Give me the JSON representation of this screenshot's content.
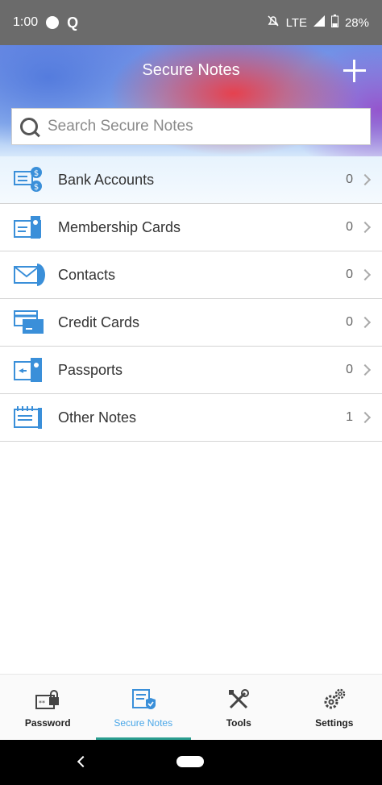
{
  "status_bar": {
    "time": "1:00",
    "network": "LTE",
    "battery": "28%"
  },
  "header": {
    "title": "Secure Notes",
    "add_icon": "plus-icon"
  },
  "search": {
    "placeholder": "Search Secure Notes"
  },
  "categories": [
    {
      "label": "Bank Accounts",
      "count": "0",
      "icon": "bank-accounts-icon"
    },
    {
      "label": "Membership Cards",
      "count": "0",
      "icon": "membership-card-icon"
    },
    {
      "label": "Contacts",
      "count": "0",
      "icon": "contact-envelope-icon"
    },
    {
      "label": "Credit Cards",
      "count": "0",
      "icon": "credit-card-icon"
    },
    {
      "label": "Passports",
      "count": "0",
      "icon": "passport-icon"
    },
    {
      "label": "Other Notes",
      "count": "1",
      "icon": "notepad-icon"
    }
  ],
  "bottom_nav": [
    {
      "label": "Password",
      "icon": "password-lock-icon"
    },
    {
      "label": "Secure Notes",
      "icon": "secure-notes-icon",
      "active": true
    },
    {
      "label": "Tools",
      "icon": "tools-icon"
    },
    {
      "label": "Settings",
      "icon": "settings-gears-icon"
    }
  ],
  "colors": {
    "accent": "#4aa7e8",
    "active_indicator": "#2a9d8f",
    "icon_blue": "#3a8fd9"
  }
}
